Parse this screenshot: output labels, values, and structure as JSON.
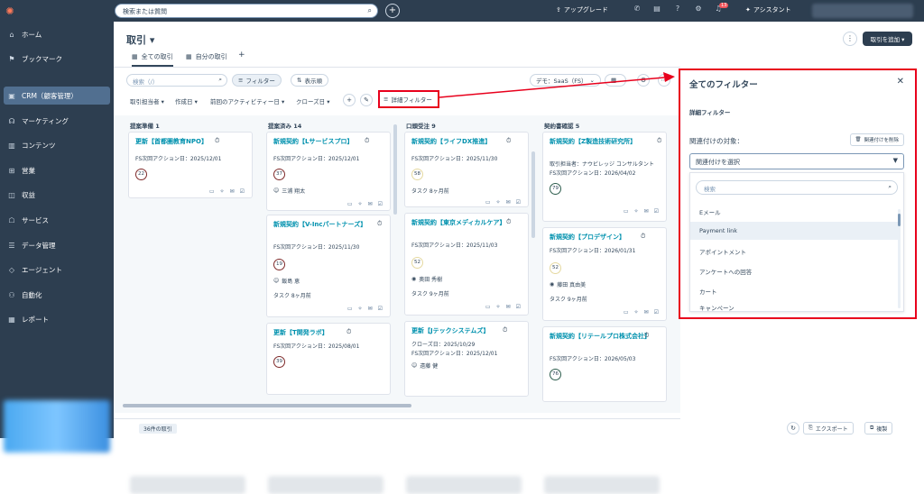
{
  "topbar": {
    "search_placeholder": "検索または質問",
    "upgrade": "アップグレード",
    "assistant": "アシスタント",
    "notif_count": "13"
  },
  "sidebar": {
    "items": [
      {
        "label": "ホーム",
        "icon": "home-icon"
      },
      {
        "label": "ブックマーク",
        "icon": "bookmark-icon"
      },
      {
        "label": "CRM（顧客管理）",
        "icon": "crm-icon"
      },
      {
        "label": "マーケティング",
        "icon": "marketing-icon"
      },
      {
        "label": "コンテンツ",
        "icon": "content-icon"
      },
      {
        "label": "営業",
        "icon": "sales-icon"
      },
      {
        "label": "収益",
        "icon": "revenue-icon"
      },
      {
        "label": "サービス",
        "icon": "service-icon"
      },
      {
        "label": "データ管理",
        "icon": "data-icon"
      },
      {
        "label": "エージェント",
        "icon": "agent-icon"
      },
      {
        "label": "自動化",
        "icon": "automation-icon"
      },
      {
        "label": "レポート",
        "icon": "report-icon"
      }
    ]
  },
  "main": {
    "title": "取引 ▾",
    "tabs": [
      "全ての取引",
      "自分の取引"
    ],
    "search_placeholder": "検索（/）",
    "filter_btn": "フィルター",
    "view_btn": "表示順",
    "pipeline": "デモ：SaaS（FS）",
    "filters": [
      "取引担当者 ▾",
      "作成日 ▾",
      "前回のアクティビティー日 ▾",
      "クローズ日 ▾"
    ],
    "adv_filter": "詳細フィルター",
    "deal_count": "36件の取引",
    "add_deal": "取引を追加 ▾",
    "export": "エクスポート",
    "duplicate": "複製"
  },
  "columns": [
    {
      "head": "提案準備 1",
      "cards": [
        {
          "title": "更新【首都圏教育NPO】",
          "lines": [
            "FS次回アクション日：2025/12/01"
          ],
          "score": "22",
          "owner": "",
          "task": ""
        }
      ]
    },
    {
      "head": "提案済み 14",
      "cards": [
        {
          "title": "新規契約【Lサービスプロ】",
          "lines": [
            "FS次回アクション日：2025/12/01"
          ],
          "score": "37",
          "owner": "三浦 翔太",
          "task": ""
        },
        {
          "title": "新規契約【V-Incパートナーズ】",
          "lines": [
            "FS次回アクション日：2025/11/30"
          ],
          "score": "19",
          "owner": "飯島 恵",
          "task": "タスク 8ヶ月前"
        },
        {
          "title": "更新【T開発ラボ】",
          "lines": [
            "FS次回アクション日：2025/08/01"
          ],
          "score": "39",
          "owner": "",
          "task": ""
        }
      ]
    },
    {
      "head": "口頭受注 9",
      "cards": [
        {
          "title": "新規契約【ライフDX推進】",
          "lines": [
            "FS次回アクション日：2025/11/30"
          ],
          "score": "58",
          "owner": "",
          "task": "タスク 8ヶ月前"
        },
        {
          "title": "新規契約【東京メディカルケア】",
          "lines": [
            "FS次回アクション日：2025/11/03"
          ],
          "score": "52",
          "owner": "奥田 秀樹",
          "task": "タスク 9ヶ月前"
        },
        {
          "title": "更新【Jテックシステムズ】",
          "lines": [
            "クローズ日：2025/10/29",
            "FS次回アクション日：2025/12/01"
          ],
          "score": "",
          "owner": "遠藤 健",
          "task": ""
        }
      ]
    },
    {
      "head": "契約書確認 5",
      "cards": [
        {
          "title": "新規契約【Z製造技術研究所】",
          "lines": [
            "取引担当者：ナウビレッジ コンサルタント",
            "FS次回アクション日：2026/04/02"
          ],
          "score": "79",
          "owner": "",
          "task": ""
        },
        {
          "title": "新規契約【プロデザイン】",
          "lines": [
            "FS次回アクション日：2026/01/31"
          ],
          "score": "52",
          "owner": "藤田 真由美",
          "task": "タスク 9ヶ月前"
        },
        {
          "title": "新規契約【リテールプロ株式会社】",
          "lines": [
            "FS次回アクション日：2026/05/03"
          ],
          "score": "76",
          "owner": "",
          "task": ""
        }
      ]
    }
  ],
  "panel": {
    "title": "全てのフィルター",
    "subtitle": "詳細フィルター",
    "assoc_label": "関連付けの対象：",
    "remove_btn": "関連付けを削除",
    "select_placeholder": "関連付けを選択",
    "search_placeholder": "検索",
    "options": [
      "Eメール",
      "Payment link",
      "アポイントメント",
      "アンケートへの回答",
      "カート",
      "キャンペーン"
    ]
  },
  "colors": {
    "highlight": "#e8001c",
    "nav_bg": "#2d3e50",
    "link": "#0091ae"
  }
}
